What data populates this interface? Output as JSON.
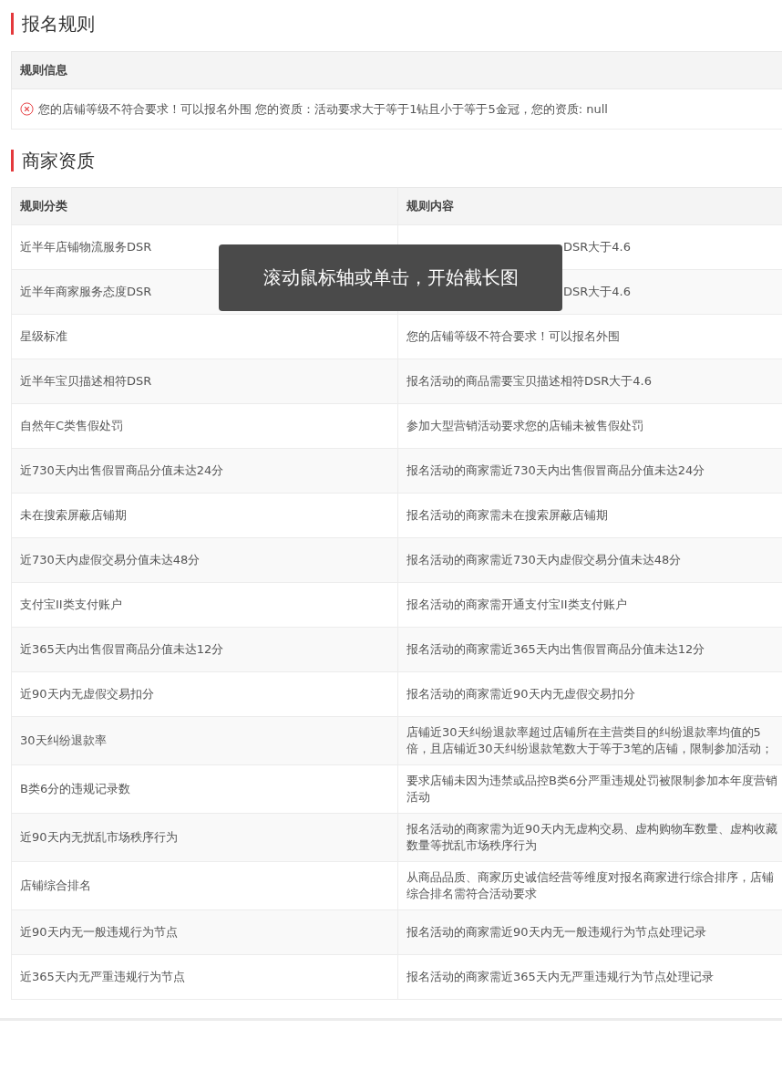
{
  "signup_rules": {
    "title": "报名规则",
    "table": {
      "columns": [
        "规则信息"
      ],
      "rows": [
        {
          "kind": "error",
          "text": "您的店铺等级不符合要求！可以报名外围 您的资质：活动要求大于等于1钻且小于等于5金冠，您的资质: null"
        }
      ]
    }
  },
  "merchant_qualification": {
    "title": "商家资质",
    "table": {
      "columns": [
        "规则分类",
        "规则内容"
      ],
      "rows": [
        [
          "近半年店铺物流服务DSR",
          {
            "text": "DSR大于4.6",
            "covered_by_overlay": true
          }
        ],
        [
          "近半年商家服务态度DSR",
          {
            "text": "DSR大于4.6",
            "covered_by_overlay": true
          }
        ],
        [
          "星级标准",
          "您的店铺等级不符合要求！可以报名外围"
        ],
        [
          "近半年宝贝描述相符DSR",
          "报名活动的商品需要宝贝描述相符DSR大于4.6"
        ],
        [
          "自然年C类售假处罚",
          "参加大型营销活动要求您的店铺未被售假处罚"
        ],
        [
          "近730天内出售假冒商品分值未达24分",
          "报名活动的商家需近730天内出售假冒商品分值未达24分"
        ],
        [
          "未在搜索屏蔽店铺期",
          "报名活动的商家需未在搜索屏蔽店铺期"
        ],
        [
          "近730天内虚假交易分值未达48分",
          "报名活动的商家需近730天内虚假交易分值未达48分"
        ],
        [
          "支付宝II类支付账户",
          "报名活动的商家需开通支付宝II类支付账户"
        ],
        [
          "近365天内出售假冒商品分值未达12分",
          "报名活动的商家需近365天内出售假冒商品分值未达12分"
        ],
        [
          "近90天内无虚假交易扣分",
          "报名活动的商家需近90天内无虚假交易扣分"
        ],
        [
          "30天纠纷退款率",
          "店铺近30天纠纷退款率超过店铺所在主营类目的纠纷退款率均值的5倍，且店铺近30天纠纷退款笔数大于等于3笔的店铺，限制参加活动；"
        ],
        [
          "B类6分的违规记录数",
          "要求店铺未因为违禁或品控B类6分严重违规处罚被限制参加本年度营销活动"
        ],
        [
          "近90天内无扰乱市场秩序行为",
          "报名活动的商家需为近90天内无虚构交易、虚构购物车数量、虚构收藏数量等扰乱市场秩序行为"
        ],
        [
          "店铺综合排名",
          "从商品品质、商家历史诚信经营等维度对报名商家进行综合排序，店铺综合排名需符合活动要求"
        ],
        [
          "近90天内无一般违规行为节点",
          "报名活动的商家需近90天内无一般违规行为节点处理记录"
        ],
        [
          "近365天内无严重违规行为节点",
          "报名活动的商家需近365天内无严重违规行为节点处理记录"
        ]
      ]
    }
  },
  "overlay": {
    "text": "滚动鼠标轴或单击，开始截长图"
  }
}
